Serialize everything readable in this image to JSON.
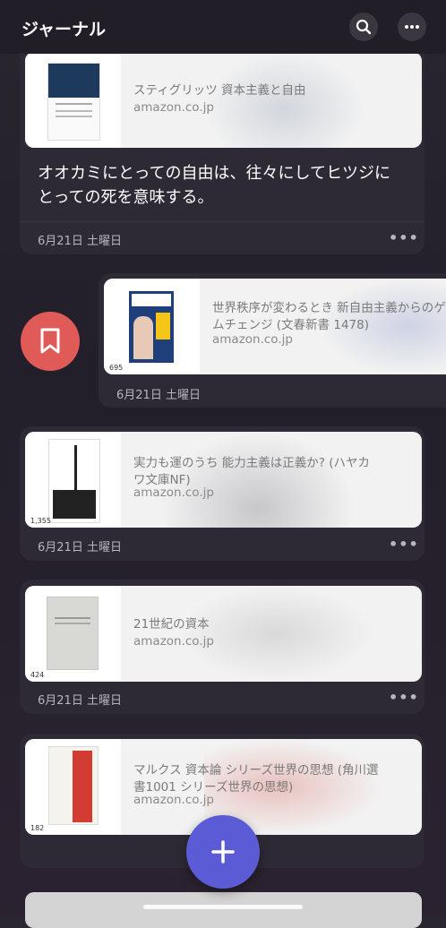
{
  "header": {
    "title": "ジャーナル",
    "search_icon": "search-icon",
    "more_icon": "more-icon"
  },
  "entries": [
    {
      "title": "スティグリッツ 資本主義と自由",
      "domain": "amazon.co.jp",
      "note": "オオカミにとっての自由は、往々にしてヒツジにとっての死を意味する。",
      "date": "6月21日 土曜日"
    },
    {
      "title": "世界秩序が変わるとき 新自由主義からのゲームチェンジ (文春新書 1478)",
      "domain": "amazon.co.jp",
      "date": "6月21日 土曜日",
      "thumb_number": "695"
    },
    {
      "title": "実力も運のうち 能力主義は正義か? (ハヤカワ文庫NF)",
      "domain": "amazon.co.jp",
      "date": "6月21日 土曜日",
      "thumb_number": "1,355"
    },
    {
      "title": "21世紀の資本",
      "domain": "amazon.co.jp",
      "date": "6月21日 土曜日",
      "thumb_number": "424"
    },
    {
      "title": "マルクス 資本論 シリーズ世界の思想 (角川選書1001 シリーズ世界の思想)",
      "domain": "amazon.co.jp",
      "thumb_number": "182"
    }
  ],
  "swipe_action": {
    "icon": "bookmark-icon",
    "color": "#e05a57"
  },
  "fab": {
    "icon": "plus-icon",
    "color": "#5b5bd6"
  },
  "colors": {
    "background": "#241f2b",
    "card": "#2e2a35",
    "accent": "#5b5bd6"
  }
}
